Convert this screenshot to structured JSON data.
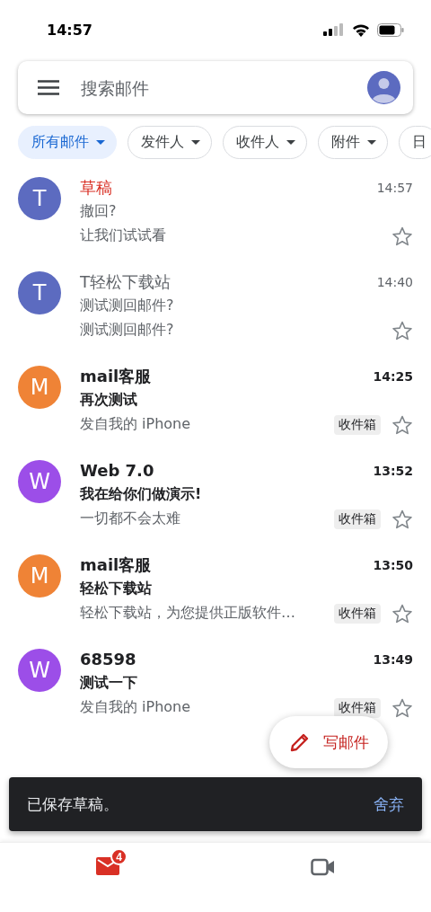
{
  "status_bar": {
    "time": "14:57"
  },
  "search": {
    "placeholder": "搜索邮件"
  },
  "filters": [
    {
      "label": "所有邮件",
      "selected": true,
      "dropdown": true
    },
    {
      "label": "发件人",
      "selected": false,
      "dropdown": true
    },
    {
      "label": "收件人",
      "selected": false,
      "dropdown": true
    },
    {
      "label": "附件",
      "selected": false,
      "dropdown": true
    },
    {
      "label": "日",
      "selected": false,
      "dropdown": false
    }
  ],
  "emails": [
    {
      "kind": "draft",
      "initial": "T",
      "color": "#5c6bc0",
      "sender": "草稿",
      "time": "14:57",
      "subject": "撤回?",
      "snippet": "让我们试试看",
      "unread": false,
      "starred": false
    },
    {
      "kind": "mail",
      "initial": "T",
      "color": "#5c6bc0",
      "sender": "T轻松下载站",
      "time": "14:40",
      "subject": "测试测回邮件?",
      "snippet": "测试测回邮件?",
      "unread": false,
      "starred": false
    },
    {
      "kind": "mail",
      "initial": "M",
      "color": "#ef8336",
      "sender": "mail客服",
      "time": "14:25",
      "subject": "再次测试",
      "snippet": "发自我的 iPhone",
      "label": "收件箱",
      "unread": true,
      "starred": false
    },
    {
      "kind": "mail",
      "initial": "W",
      "color": "#9c4ee8",
      "sender": "Web 7.0",
      "time": "13:52",
      "subject": "我在给你们做演示!",
      "snippet": "一切都不会太难",
      "label": "收件箱",
      "unread": true,
      "starred": false
    },
    {
      "kind": "mail",
      "initial": "M",
      "color": "#ef8336",
      "sender": "mail客服",
      "time": "13:50",
      "subject": "轻松下载站",
      "snippet": "轻松下载站，为您提供正版软件…",
      "label": "收件箱",
      "unread": true,
      "starred": false
    },
    {
      "kind": "mail",
      "initial": "W",
      "color": "#9c4ee8",
      "sender": "68598",
      "time": "13:49",
      "subject": "测试一下",
      "snippet": "发自我的 iPhone",
      "label": "收件箱",
      "unread": true,
      "starred": false
    }
  ],
  "compose_button": {
    "label": "写邮件"
  },
  "snackbar": {
    "message": "已保存草稿。",
    "action": "舍弃"
  },
  "bottom_nav": {
    "mail_badge": "4",
    "tabs": [
      {
        "kind": "mail",
        "selected": true
      },
      {
        "kind": "meet",
        "selected": false
      }
    ]
  }
}
